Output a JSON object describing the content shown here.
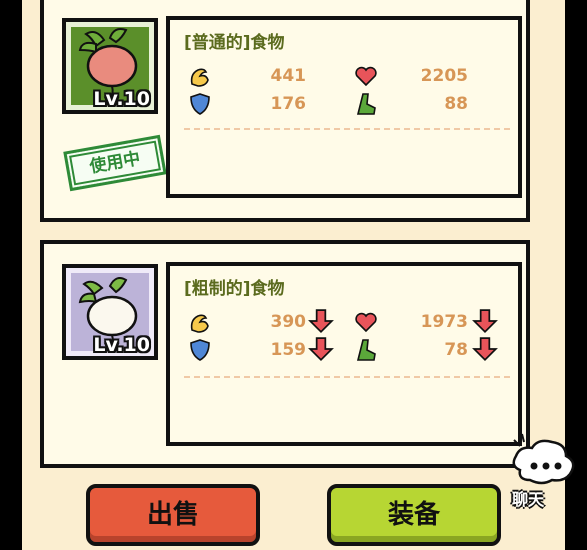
{
  "items": [
    {
      "title": "[普通的]食物",
      "level": "Lv.10",
      "status": "使用中",
      "attack": "441",
      "hp": "2205",
      "defense": "176",
      "speed": "88",
      "icon_bg": "#5b8f2a",
      "icon": "red-radish-icon"
    },
    {
      "title": "[粗制的]食物",
      "level": "Lv.10",
      "attack": "390",
      "hp": "1973",
      "defense": "159",
      "speed": "78",
      "icon_bg": "#bcb3d8",
      "icon": "white-radish-icon",
      "stat_trend": "down"
    }
  ],
  "buttons": {
    "sell": "出售",
    "equip": "装备"
  },
  "chat": {
    "label": "聊天",
    "icon": "chat-bubble-icon"
  },
  "colors": {
    "sell": "#e65a3c",
    "equip": "#b7d633",
    "stat_value": "#d79656",
    "decrease_arrow": "#e8545a",
    "in_use_stamp": "#2e8a37"
  }
}
